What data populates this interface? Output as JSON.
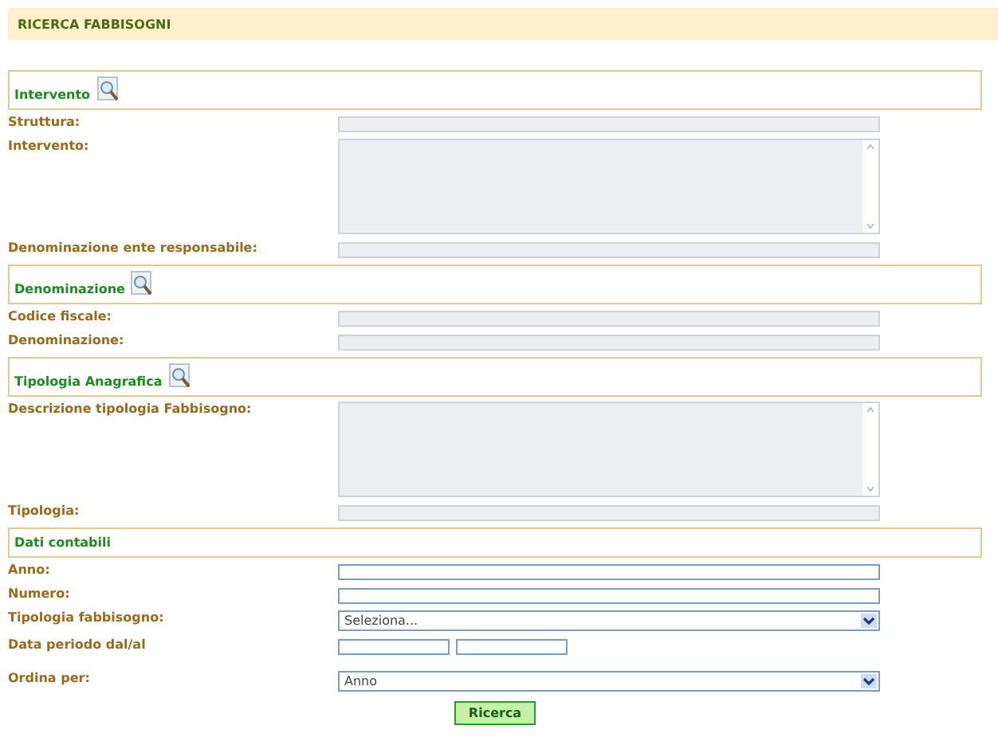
{
  "title": "RICERCA FABBISOGNI",
  "sections": [
    {
      "heading": "Intervento",
      "search_icon": true,
      "fields": [
        {
          "label": "Struttura:",
          "kind": "readonly"
        },
        {
          "label": "Intervento:",
          "kind": "textarea"
        },
        {
          "label": "Denominazione ente responsabile:",
          "kind": "readonly"
        }
      ]
    },
    {
      "heading": "Denominazione",
      "search_icon": true,
      "fields": [
        {
          "label": "Codice fiscale:",
          "kind": "readonly"
        },
        {
          "label": "Denominazione:",
          "kind": "readonly"
        }
      ]
    },
    {
      "heading": "Tipologia Anagrafica",
      "search_icon": true,
      "fields": [
        {
          "label": "Descrizione tipologia Fabbisogno:",
          "kind": "textarea"
        },
        {
          "label": "Tipologia:",
          "kind": "readonly"
        }
      ]
    },
    {
      "heading": "Dati contabili",
      "search_icon": false,
      "fields": [
        {
          "label": "Anno:",
          "kind": "text"
        },
        {
          "label": "Numero:",
          "kind": "text"
        },
        {
          "label": "Tipologia fabbisogno:",
          "kind": "select",
          "value": "Seleziona..."
        },
        {
          "label": "Data periodo dal/al",
          "kind": "daterange"
        },
        {
          "label": "Ordina per:",
          "kind": "select",
          "value": "Anno"
        }
      ]
    }
  ],
  "button": "Ricerca"
}
